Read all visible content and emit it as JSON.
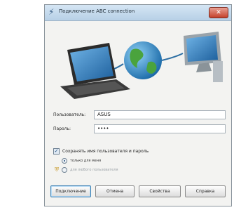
{
  "window": {
    "title": "Подключение ABC connection",
    "close_glyph": "✕",
    "title_icon": "network-connection-icon"
  },
  "form": {
    "username_label": "Пользователь:",
    "username_value": "ASUS",
    "password_label": "Пароль:",
    "password_value": "••••",
    "save_checkbox_label": "Сохранять имя пользователя и пароль",
    "save_checked": true,
    "radio_only_me": "только для меня",
    "radio_any_user": "для любого пользователя"
  },
  "buttons": {
    "connect": "Подключение",
    "cancel": "Отмена",
    "properties": "Свойства",
    "help": "Справка"
  },
  "colors": {
    "titlebar": "#c6dcee",
    "accent": "#3c7fb1",
    "globe": "#2f8fd1",
    "globe_land": "#4aa33d"
  }
}
